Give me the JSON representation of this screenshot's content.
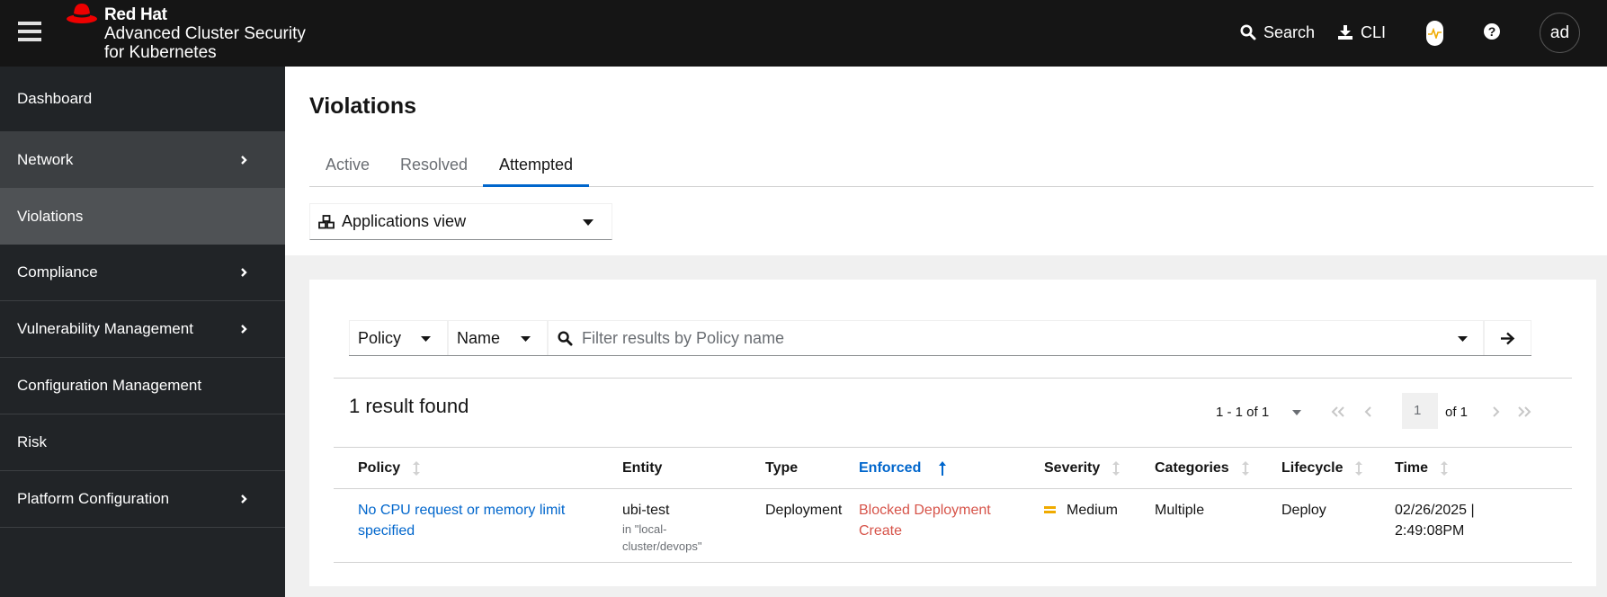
{
  "masthead": {
    "brand_company": "Red Hat",
    "brand_product_line1": "Advanced Cluster Security",
    "brand_product_line2": "for Kubernetes",
    "search_label": "Search",
    "cli_label": "CLI",
    "help_glyph": "?",
    "avatar_initials": "ad",
    "health_color": "#f0ab00",
    "brand_color": "#ee0000"
  },
  "sidebar": {
    "items": [
      {
        "label": "Dashboard",
        "expandable": false
      },
      {
        "label": "Network",
        "expandable": true
      },
      {
        "label": "Violations",
        "expandable": false,
        "current": true
      },
      {
        "label": "Compliance",
        "expandable": true
      },
      {
        "label": "Vulnerability Management",
        "expandable": true
      },
      {
        "label": "Configuration Management",
        "expandable": false
      },
      {
        "label": "Risk",
        "expandable": false
      },
      {
        "label": "Platform Configuration",
        "expandable": true
      }
    ]
  },
  "page": {
    "title": "Violations",
    "tabs": [
      {
        "label": "Active",
        "active": false
      },
      {
        "label": "Resolved",
        "active": false
      },
      {
        "label": "Attempted",
        "active": true
      }
    ],
    "view_select": {
      "value": "Applications view",
      "icon": "cubes-icon"
    }
  },
  "filter": {
    "attribute_select": "Policy",
    "field_select": "Name",
    "placeholder": "Filter results by Policy name",
    "value": ""
  },
  "results": {
    "count_text": "1 result found",
    "pagination": {
      "range_text": "1 - 1 of 1",
      "current_page": "1",
      "of_text": "of 1"
    }
  },
  "table": {
    "columns": [
      {
        "label": "Policy",
        "sortable": true,
        "sorted": false
      },
      {
        "label": "Entity",
        "sortable": false,
        "sorted": false
      },
      {
        "label": "Type",
        "sortable": false,
        "sorted": false
      },
      {
        "label": "Enforced",
        "sortable": true,
        "sorted": true,
        "direction": "asc"
      },
      {
        "label": "Severity",
        "sortable": true,
        "sorted": false
      },
      {
        "label": "Categories",
        "sortable": true,
        "sorted": false
      },
      {
        "label": "Lifecycle",
        "sortable": true,
        "sorted": false
      },
      {
        "label": "Time",
        "sortable": true,
        "sorted": false
      }
    ],
    "rows": [
      {
        "policy_line1": "No CPU request or memory limit",
        "policy_line2": "specified",
        "entity": "ubi-test",
        "entity_sub_line1": "in \"local-",
        "entity_sub_line2": "cluster/devops\"",
        "type": "Deployment",
        "enforced_line1": "Blocked Deployment",
        "enforced_line2": "Create",
        "severity": "Medium",
        "severity_color": "#f0ab00",
        "categories": "Multiple",
        "lifecycle": "Deploy",
        "time_line1": "02/26/2025 |",
        "time_line2": "2:49:08PM"
      }
    ]
  }
}
